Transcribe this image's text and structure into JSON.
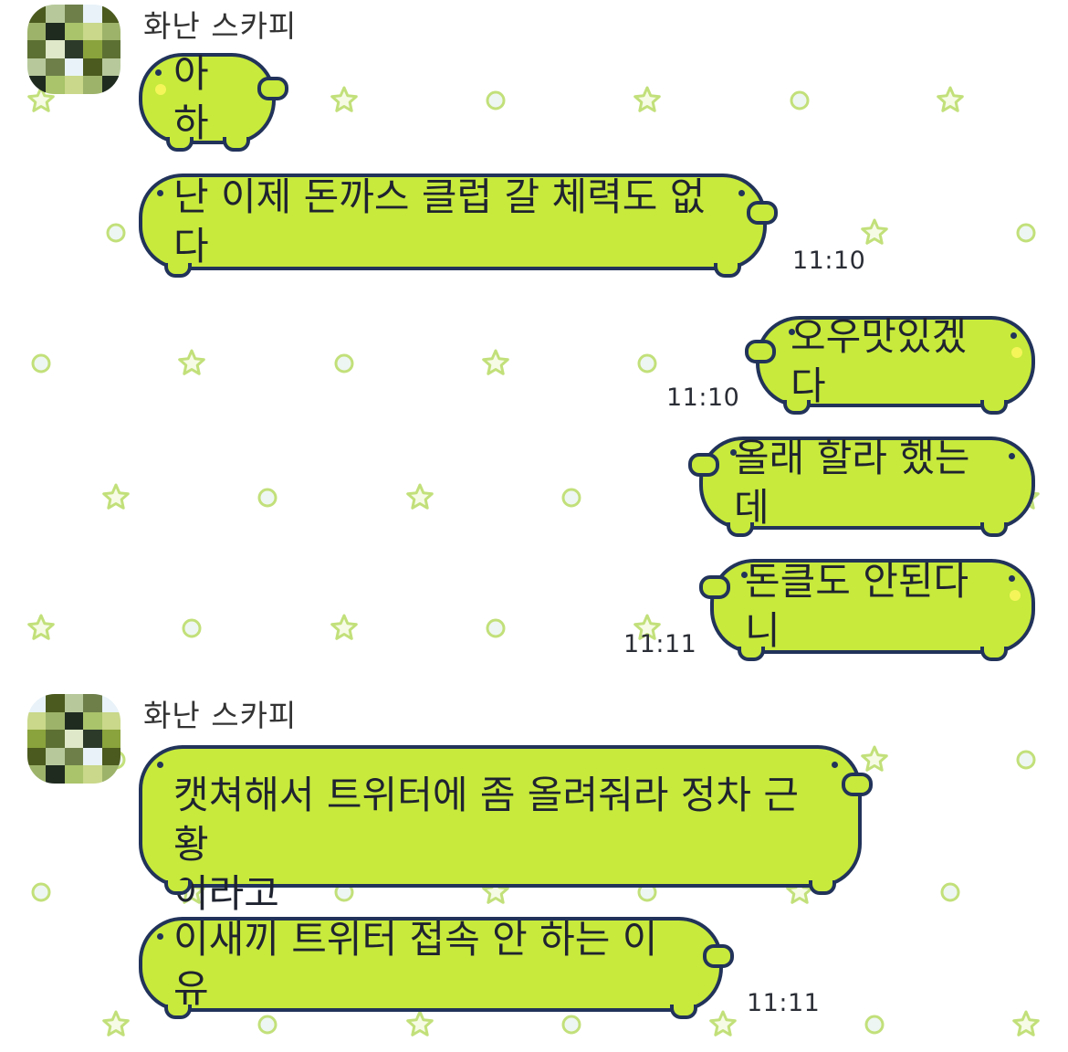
{
  "chat": {
    "sender_name_1": "화난 스카피",
    "sender_name_2": "화난 스카피",
    "messages": [
      {
        "text": "아하",
        "time": ""
      },
      {
        "text": "난 이제 돈까스 클럽 갈 체력도 없다",
        "time": "11:10"
      },
      {
        "text": "오우맛있겠다",
        "time": "11:10"
      },
      {
        "text": "올래 할라 했는데",
        "time": ""
      },
      {
        "text": "돈클도 안된다니",
        "time": "11:11"
      },
      {
        "text": "캣쳐해서 트위터에 좀 올려줘라 정차 근황\n이라고",
        "time": ""
      },
      {
        "text": "이새끼 트위터 접속 안 하는 이유",
        "time": "11:11"
      }
    ]
  },
  "colors": {
    "bubble": "#c7ea3c",
    "outline": "#22335a",
    "pattern": "#c2e07a"
  }
}
